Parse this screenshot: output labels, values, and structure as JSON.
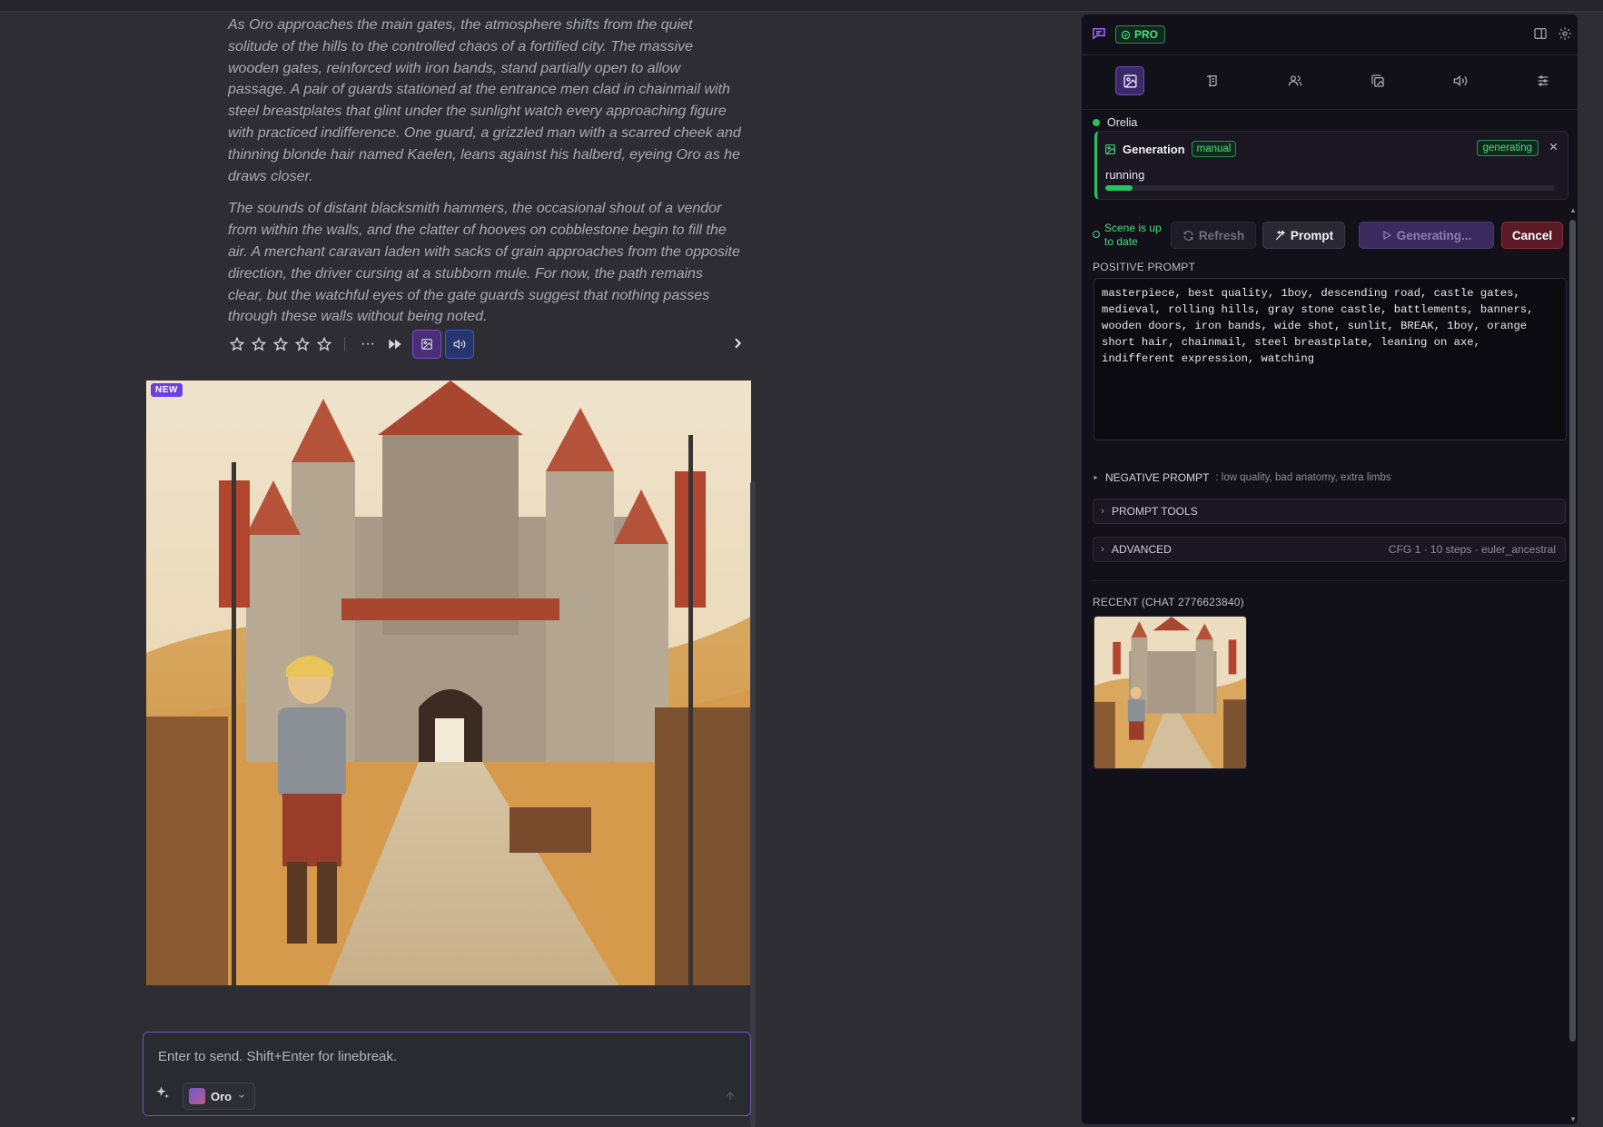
{
  "story": {
    "paragraphs": [
      "As Oro approaches the main gates, the atmosphere shifts from the quiet solitude of the hills to the controlled chaos of a fortified city. The massive wooden gates, reinforced with iron bands, stand partially open to allow passage. A pair of guards stationed at the entrance men clad in chainmail with steel breastplates that glint under the sunlight watch every approaching figure with practiced indifference. One guard, a grizzled man with a scarred cheek and thinning blonde hair named Kaelen, leans against his halberd, eyeing Oro as he draws closer.",
      "The sounds of distant blacksmith hammers, the occasional shout of a vendor from within the walls, and the clatter of hooves on cobblestone begin to fill the air. A merchant caravan laden with sacks of grain approaches from the opposite direction, the driver cursing at a stubborn mule. For now, the path remains clear, but the watchful eyes of the gate guards suggest that nothing passes through these walls without being noted."
    ]
  },
  "message_actions": {
    "rating": 0,
    "rating_max": 5,
    "more_label": "···"
  },
  "image": {
    "badge": "NEW"
  },
  "composer": {
    "placeholder": "Enter to send. Shift+Enter for linebreak.",
    "character": "Oro"
  },
  "panel": {
    "pro_label": "PRO",
    "character_name": "Orelia",
    "generation": {
      "title": "Generation",
      "mode": "manual",
      "state": "generating",
      "status": "running",
      "progress": 0.06
    },
    "scene_status": "Scene is up to date",
    "buttons": {
      "refresh": "Refresh",
      "prompt": "Prompt",
      "generating": "Generating...",
      "cancel": "Cancel"
    },
    "positive_label": "POSITIVE PROMPT",
    "positive_prompt": "masterpiece, best quality, 1boy, descending road, castle gates, medieval, rolling hills, gray stone castle, battlements, banners, wooden doors, iron bands, wide shot, sunlit, BREAK, 1boy, orange short hair, chainmail, steel breastplate, leaning on axe, indifferent expression, watching",
    "negative_label": "NEGATIVE PROMPT",
    "negative_value": ": low quality, bad anatomy, extra limbs",
    "prompt_tools_label": "PROMPT TOOLS",
    "advanced_label": "ADVANCED",
    "advanced_meta": "CFG 1 · 10 steps · euler_ancestral",
    "recent_label": "RECENT (CHAT 2776623840)"
  },
  "colors": {
    "accent": "#6d3fe0",
    "success": "#22c55e",
    "danger": "#8a2a3a"
  }
}
